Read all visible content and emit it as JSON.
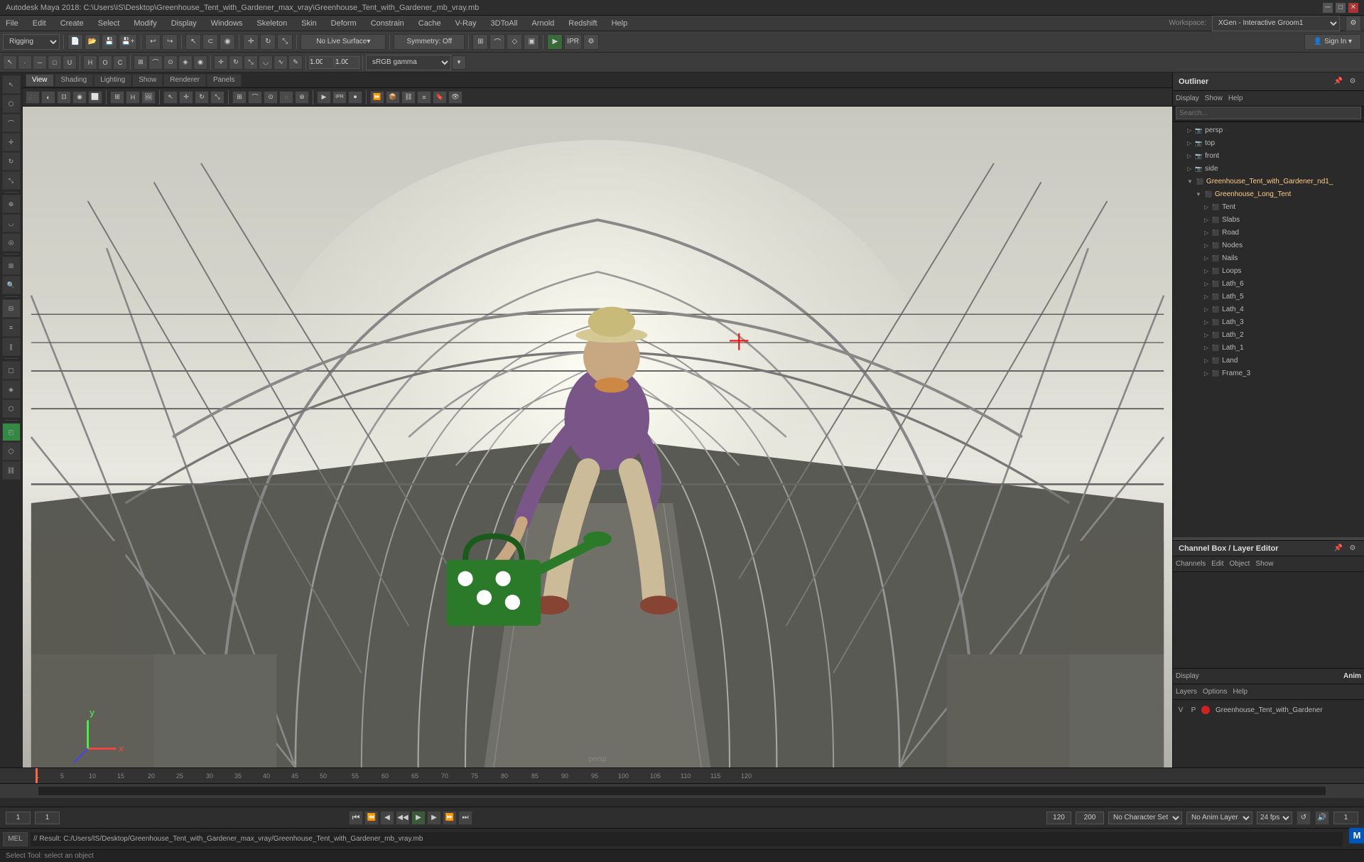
{
  "app": {
    "title": "Autodesk Maya 2018: C:\\Users\\IS\\Desktop\\Greenhouse_Tent_with_Gardener_max_vray\\Greenhouse_Tent_with_Gardener_mb_vray.mb",
    "workspace": "XGen - Interactive Groom1",
    "logo": "M"
  },
  "menu": {
    "items": [
      "File",
      "Edit",
      "Create",
      "Select",
      "Modify",
      "Display",
      "Windows",
      "Skeleton",
      "Skin",
      "Deform",
      "Constrain",
      "Cache",
      "V-Ray",
      "3DtoAll",
      "Arnold",
      "Redshift",
      "Help"
    ]
  },
  "main_toolbar": {
    "mode_dropdown": "Rigging",
    "no_live_surface": "No Live Surface",
    "symmetry": "Symmetry: Off"
  },
  "viewport": {
    "tabs": [
      "View",
      "Shading",
      "Lighting",
      "Show",
      "Renderer",
      "Panels"
    ],
    "label": "persp",
    "gamma_value": "1.00",
    "colorspace": "sRGB gamma",
    "no_live": "No Live Surface",
    "symmetry_off": "Symmetry: Off"
  },
  "outliner": {
    "title": "Outliner",
    "tabs": [
      "Display",
      "Show",
      "Help"
    ],
    "search_placeholder": "Search...",
    "items": [
      {
        "label": "persp",
        "indent": 1,
        "type": "camera",
        "expanded": false
      },
      {
        "label": "top",
        "indent": 1,
        "type": "camera",
        "expanded": false
      },
      {
        "label": "front",
        "indent": 1,
        "type": "camera",
        "expanded": false
      },
      {
        "label": "side",
        "indent": 1,
        "type": "camera",
        "expanded": false
      },
      {
        "label": "Greenhouse_Tent_with_Gardener_nd1_",
        "indent": 1,
        "type": "group",
        "expanded": true
      },
      {
        "label": "Greenhouse_Long_Tent",
        "indent": 2,
        "type": "group",
        "expanded": true
      },
      {
        "label": "Tent",
        "indent": 3,
        "type": "mesh",
        "expanded": false
      },
      {
        "label": "Slabs",
        "indent": 3,
        "type": "mesh",
        "expanded": false
      },
      {
        "label": "Road",
        "indent": 3,
        "type": "mesh",
        "expanded": false
      },
      {
        "label": "Nodes",
        "indent": 3,
        "type": "mesh",
        "expanded": false
      },
      {
        "label": "Nails",
        "indent": 3,
        "type": "mesh",
        "expanded": false
      },
      {
        "label": "Loops",
        "indent": 3,
        "type": "mesh",
        "expanded": false
      },
      {
        "label": "Lath_6",
        "indent": 3,
        "type": "mesh",
        "expanded": false
      },
      {
        "label": "Lath_5",
        "indent": 3,
        "type": "mesh",
        "expanded": false
      },
      {
        "label": "Lath_4",
        "indent": 3,
        "type": "mesh",
        "expanded": false
      },
      {
        "label": "Lath_3",
        "indent": 3,
        "type": "mesh",
        "expanded": false
      },
      {
        "label": "Lath_2",
        "indent": 3,
        "type": "mesh",
        "expanded": false
      },
      {
        "label": "Lath_1",
        "indent": 3,
        "type": "mesh",
        "expanded": false
      },
      {
        "label": "Land",
        "indent": 3,
        "type": "mesh",
        "expanded": false
      },
      {
        "label": "Frame_3",
        "indent": 3,
        "type": "mesh",
        "expanded": false
      }
    ]
  },
  "channel_box": {
    "title": "Channel Box / Layer Editor",
    "tabs": [
      "Channels",
      "Edit",
      "Object",
      "Show"
    ]
  },
  "layer_editor": {
    "display_tab": "Display",
    "anim_tab": "Anim",
    "tabs": [
      "Layers",
      "Options",
      "Help"
    ],
    "layers": [
      {
        "v": "V",
        "p": "P",
        "color": "#cc2222",
        "name": "Greenhouse_Tent_with_Gardener"
      }
    ]
  },
  "timeline": {
    "start": "1",
    "end": "120",
    "range_start": "1",
    "range_end": "120",
    "current_frame": "1",
    "ticks": [
      "1",
      "5",
      "10",
      "15",
      "20",
      "25",
      "30",
      "35",
      "40",
      "45",
      "50",
      "55",
      "60",
      "65",
      "70",
      "75",
      "80",
      "85",
      "90",
      "95",
      "100",
      "105",
      "110",
      "115",
      "120"
    ],
    "animation_end": "200",
    "fps": "24 fps"
  },
  "playback": {
    "start_frame": "1",
    "end_frame": "120",
    "current": "1",
    "anim_start": "120",
    "anim_end": "200",
    "fps": "24 fps",
    "no_character_set": "No Character Set",
    "no_anim_layer": "No Anim Layer",
    "no_character": "No Character _"
  },
  "status": {
    "mode": "MEL",
    "text": "// Result: C:/Users/IS/Desktop/Greenhouse_Tent_with_Gardener_max_vray/Greenhouse_Tent_with_Gardener_mb_vray.mb",
    "help": "Select Tool: select an object"
  },
  "icons": {
    "minimize": "─",
    "maximize": "□",
    "close": "✕",
    "play": "▶",
    "play_back": "◀",
    "skip_start": "⏮",
    "skip_end": "⏭",
    "step_fwd": "⏩",
    "step_bwd": "⏪",
    "prev_key": "◂◂",
    "next_key": "▸▸",
    "arrow": "↩",
    "loop": "↺"
  }
}
